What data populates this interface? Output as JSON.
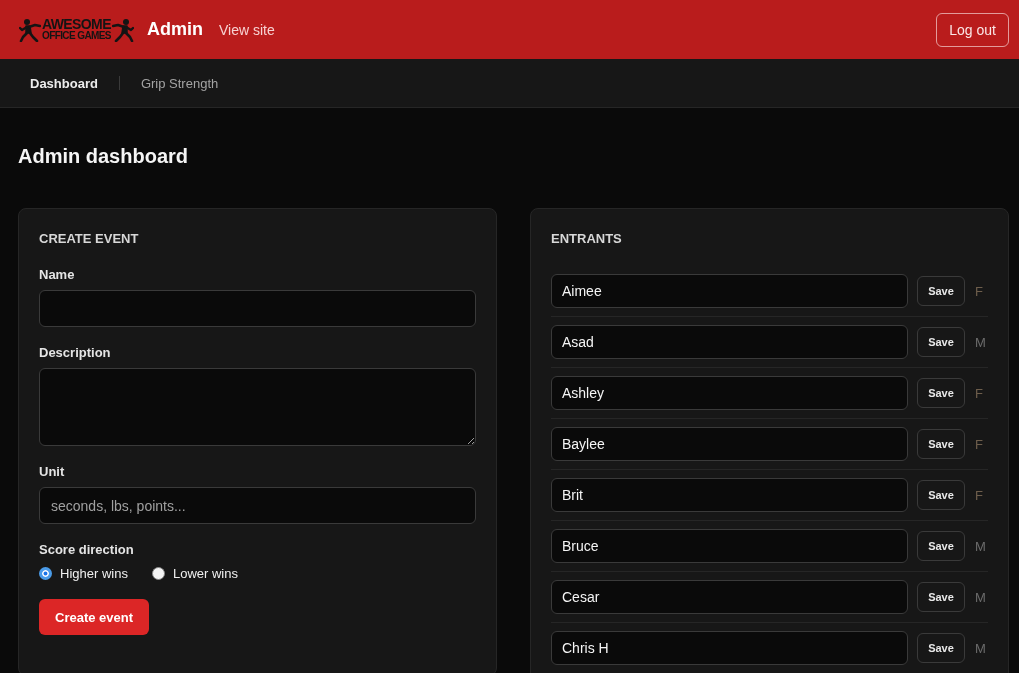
{
  "header": {
    "logo": {
      "line_1": "AWESOME",
      "line_2": "OFFICE GAMES"
    },
    "title": "Admin",
    "view_site_link": "View site",
    "logout_button": "Log out"
  },
  "nav": {
    "tabs": [
      {
        "label": "Dashboard",
        "selected": true
      },
      {
        "label": "Grip Strength",
        "selected": false
      }
    ]
  },
  "page_title": "Admin dashboard",
  "create_event": {
    "heading": "CREATE EVENT",
    "fields": [
      {
        "kind": "input",
        "label": "Name"
      },
      {
        "kind": "textarea",
        "label": "Description"
      },
      {
        "kind": "input",
        "label": "Unit",
        "placeholder": "seconds, lbs, points..."
      }
    ],
    "score_direction": {
      "label": "Score direction",
      "options": [
        {
          "label": "Higher wins",
          "selected": true
        },
        {
          "label": "Lower wins",
          "selected": false
        }
      ]
    },
    "submit_button": "Create event"
  },
  "entrants": {
    "heading": "ENTRANTS",
    "rows": [
      {
        "name": "Aimee",
        "save_button": "Save",
        "gender": "F",
        "color": "#6e5e4c"
      },
      {
        "name": "Asad",
        "save_button": "Save",
        "gender": "M",
        "color": "#6b6b6b"
      },
      {
        "name": "Ashley",
        "save_button": "Save",
        "gender": "F",
        "color": "#6e5e4c"
      },
      {
        "name": "Baylee",
        "save_button": "Save",
        "gender": "F",
        "color": "#6e5e4c"
      },
      {
        "name": "Brit",
        "save_button": "Save",
        "gender": "F",
        "color": "#6e5e4c"
      },
      {
        "name": "Bruce",
        "save_button": "Save",
        "gender": "M",
        "color": "#6b6b6b"
      },
      {
        "name": "Cesar",
        "save_button": "Save",
        "gender": "M",
        "color": "#6b6b6b"
      },
      {
        "name": "Chris H",
        "save_button": "Save",
        "gender": "M",
        "color": "#6b6b6b"
      }
    ]
  }
}
